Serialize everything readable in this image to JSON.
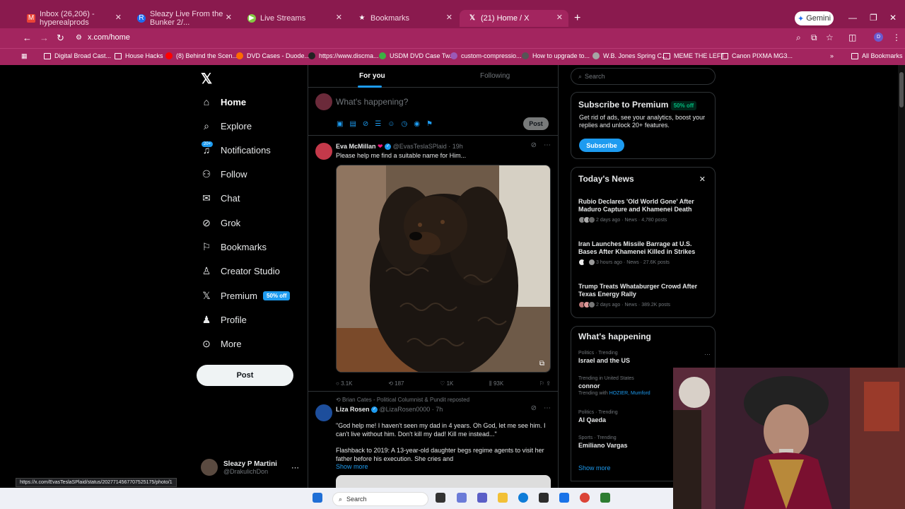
{
  "browser": {
    "tabs": [
      {
        "label": "Inbox (26,206) - hyperealprods",
        "color": "#ea4335",
        "icon": "gmail-icon"
      },
      {
        "label": "Sleazy Live From the Bunker 2/...",
        "color": "#1d6cf0",
        "icon": "rumble-icon"
      },
      {
        "label": "Live Streams",
        "color": "#85c742",
        "icon": "play-icon"
      },
      {
        "label": "Bookmarks",
        "color": "#ffffff",
        "icon": "star-icon"
      },
      {
        "label": "(21) Home / X",
        "color": "#ffffff",
        "icon": "x-icon"
      }
    ],
    "gemini_label": "Gemini",
    "url": "x.com/home",
    "bookmarks": [
      "Digital Broad Cast...",
      "House Hacks",
      "(8) Behind the Scen...",
      "DVD Cases - Duode...",
      "https://www.discma...",
      "USDM DVD Case Tw...",
      "custom-compressio...",
      "How to upgrade to...",
      "W.B. Jones Spring C...",
      "MEME THE LEFT",
      "Canon PIXMA MG3..."
    ],
    "all_bookmarks": "All Bookmarks",
    "status_url": "https://x.com/EvasTeslaSPlaid/status/2027714567707525175/photo/1"
  },
  "nav": {
    "items": [
      {
        "label": "Home",
        "icon": "home-icon",
        "glyph": "⌂"
      },
      {
        "label": "Explore",
        "icon": "search-icon",
        "glyph": "⌕"
      },
      {
        "label": "Notifications",
        "icon": "bell-icon",
        "glyph": "🔔"
      },
      {
        "label": "Follow",
        "icon": "follow-icon",
        "glyph": "👤"
      },
      {
        "label": "Chat",
        "icon": "mail-icon",
        "glyph": "✉"
      },
      {
        "label": "Grok",
        "icon": "grok-icon",
        "glyph": "⊘"
      },
      {
        "label": "Bookmarks",
        "icon": "bookmark-icon",
        "glyph": "🔖"
      },
      {
        "label": "Creator Studio",
        "icon": "creator-icon",
        "glyph": "♙"
      },
      {
        "label": "Premium",
        "icon": "x-premium-icon",
        "glyph": "𝕏"
      },
      {
        "label": "Profile",
        "icon": "profile-icon",
        "glyph": "👤"
      },
      {
        "label": "More",
        "icon": "more-icon",
        "glyph": "⋯"
      }
    ],
    "notif_badge": "20+",
    "premium_badge": "50% off",
    "post_label": "Post",
    "account_name": "Sleazy P Martini",
    "account_handle": "@DrakulichDon"
  },
  "feed": {
    "tab_foryou": "For you",
    "tab_following": "Following",
    "compose_placeholder": "What's happening?",
    "compose_post": "Post",
    "tweet1": {
      "name": "Eva McMillan",
      "heart": "❤",
      "handle": "@EvasTeslaSPlaid · 19h",
      "text": "Please help me find a suitable name for Him...",
      "replies": "3.1K",
      "reposts": "187",
      "likes": "1K",
      "views": "93K"
    },
    "tweet2": {
      "repost_note": "Brian Cates - Political Columnist & Pundit reposted",
      "name": "Liza Rosen",
      "handle": "@LizaRosen0000 · 7h",
      "text1": "\"God help me! I haven't seen my dad in 4 years. Oh God, let me see him. I can't live without him. Don't kill my dad! Kill me instead...\"",
      "text2": "Flashback to 2019: A 13-year-old daughter begs regime agents to visit her father before his execution. She cries and",
      "show_more": "Show more"
    }
  },
  "right": {
    "search_placeholder": "Search",
    "premium": {
      "title": "Subscribe to Premium",
      "badge": "50% off",
      "text": "Get rid of ads, see your analytics, boost your replies and unlock 20+ features.",
      "button": "Subscribe"
    },
    "news": {
      "title": "Today's News",
      "items": [
        {
          "headline": "Rubio Declares 'Old World Gone' After Maduro Capture and Khamenei Death",
          "meta": "2 days ago · News · 4,780 posts"
        },
        {
          "headline": "Iran Launches Missile Barrage at U.S. Bases After Khamenei Killed in Strikes",
          "meta": "3 hours ago · News · 27.6K posts"
        },
        {
          "headline": "Trump Treats Whataburger Crowd After Texas Energy Rally",
          "meta": "2 days ago · News · 389.2K posts"
        }
      ]
    },
    "happening": {
      "title": "What's happening",
      "trends": [
        {
          "context": "Politics · Trending",
          "name": "Israel and the US",
          "with": ""
        },
        {
          "context": "Trending in United States",
          "name": "connor",
          "with_prefix": "Trending with ",
          "with": "HOZIER, Mumford"
        },
        {
          "context": "Politics · Trending",
          "name": "Al Qaeda",
          "with": ""
        },
        {
          "context": "Sports · Trending",
          "name": "Emiliano Vargas",
          "with": ""
        }
      ],
      "show_more": "Show more"
    }
  },
  "taskbar": {
    "search_label": "Search"
  }
}
